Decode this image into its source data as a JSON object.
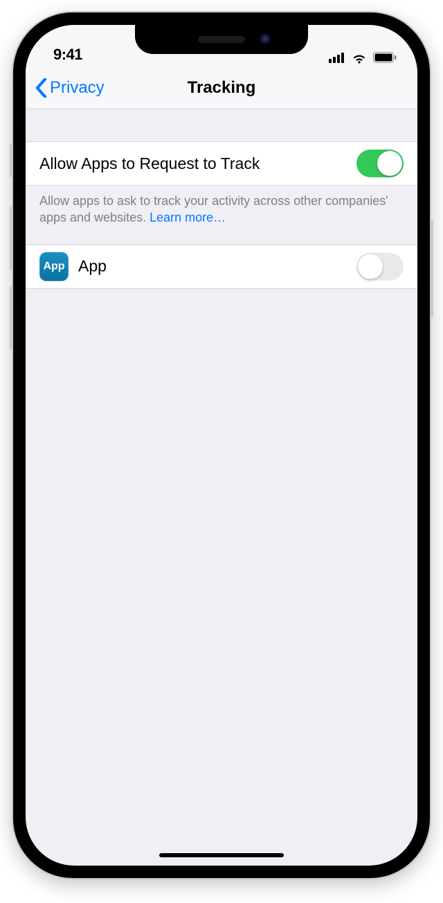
{
  "status": {
    "time": "9:41"
  },
  "nav": {
    "back_label": "Privacy",
    "title": "Tracking"
  },
  "allow_row": {
    "label": "Allow Apps to Request to Track",
    "enabled": true
  },
  "footer": {
    "text": "Allow apps to ask to track your activity across other companies' apps and websites. ",
    "link": "Learn more…"
  },
  "app_row": {
    "icon_text": "App",
    "label": "App",
    "enabled": false
  }
}
